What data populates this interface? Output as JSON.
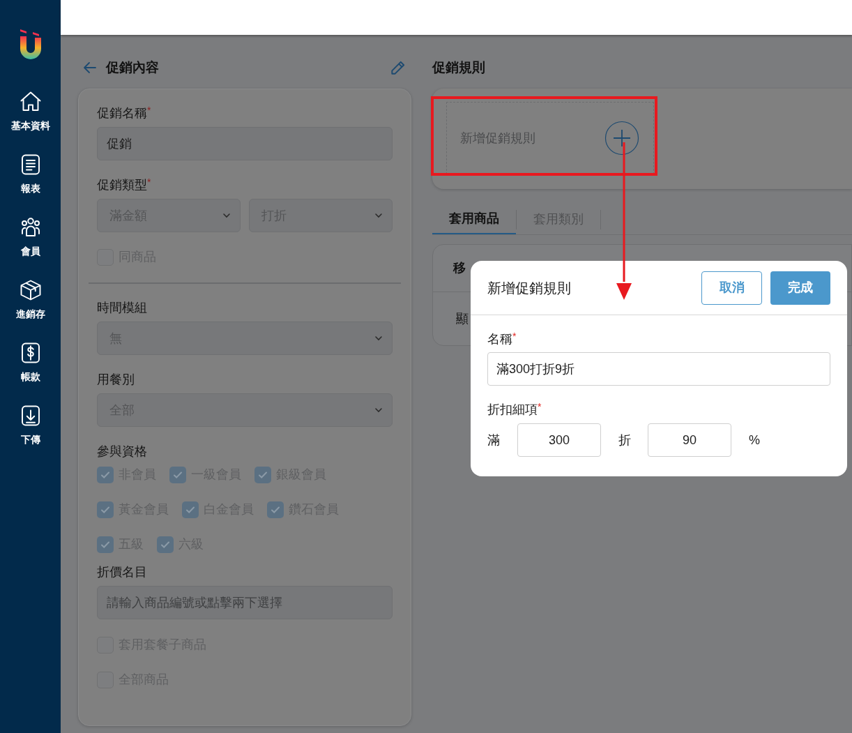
{
  "sidebar": {
    "items": [
      {
        "label": "基本資料",
        "kind": "home"
      },
      {
        "label": "報表",
        "kind": "report"
      },
      {
        "label": "會員",
        "kind": "members"
      },
      {
        "label": "進銷存",
        "kind": "box"
      },
      {
        "label": "帳款",
        "kind": "money"
      },
      {
        "label": "下傳",
        "kind": "download"
      }
    ]
  },
  "left_panel": {
    "title": "促銷內容",
    "fields": [
      {
        "kind": "input",
        "label": "促銷名稱",
        "required_mark": "*",
        "value": "促銷"
      },
      {
        "kind": "select_pair",
        "label": "促銷類型",
        "required_mark": "*",
        "values": [
          "滿金額",
          "打折"
        ]
      },
      {
        "kind": "checkbox",
        "label": "同商品",
        "checked": false
      },
      {
        "kind": "divider"
      },
      {
        "kind": "select",
        "label": "時間模組",
        "value": "無"
      },
      {
        "kind": "select",
        "label": "用餐別",
        "value": "全部"
      },
      {
        "kind": "checkbox_group",
        "label": "參與資格",
        "options": [
          {
            "label": "非會員",
            "checked": true
          },
          {
            "label": "一級會員",
            "checked": true
          },
          {
            "label": "銀級會員",
            "checked": true
          },
          {
            "label": "黃金會員",
            "checked": true
          },
          {
            "label": "白金會員",
            "checked": true
          },
          {
            "label": "鑽石會員",
            "checked": true
          },
          {
            "label": "五級",
            "checked": true
          },
          {
            "label": "六級",
            "checked": true
          }
        ]
      },
      {
        "kind": "input",
        "label": "折價名目",
        "placeholder": "請輸入商品編號或點擊兩下選擇"
      },
      {
        "kind": "checkbox",
        "label": "套用套餐子商品",
        "checked": false
      },
      {
        "kind": "checkbox",
        "label": "全部商品",
        "checked": false
      }
    ]
  },
  "right_panel": {
    "title": "促銷規則",
    "add_rule": {
      "label": "新增促銷規則"
    },
    "tabs": [
      {
        "label": "套用商品",
        "selected": true
      },
      {
        "label": "套用類別",
        "selected": false
      }
    ],
    "table": {
      "columns": [
        "移"
      ],
      "rows": [
        [
          "顯"
        ]
      ]
    }
  },
  "dialog": {
    "title": "新增促銷規則",
    "buttons": [
      {
        "label": "取消",
        "kind": "secondary"
      },
      {
        "label": "完成",
        "kind": "primary"
      }
    ],
    "name_field": {
      "label": "名稱",
      "required_mark": "*",
      "value": "滿300打折9折"
    },
    "detail": {
      "label": "折扣細項",
      "required_mark": "*",
      "prefix": "滿",
      "amount": "300",
      "middle": "折",
      "percent": "90",
      "suffix": "%"
    }
  }
}
